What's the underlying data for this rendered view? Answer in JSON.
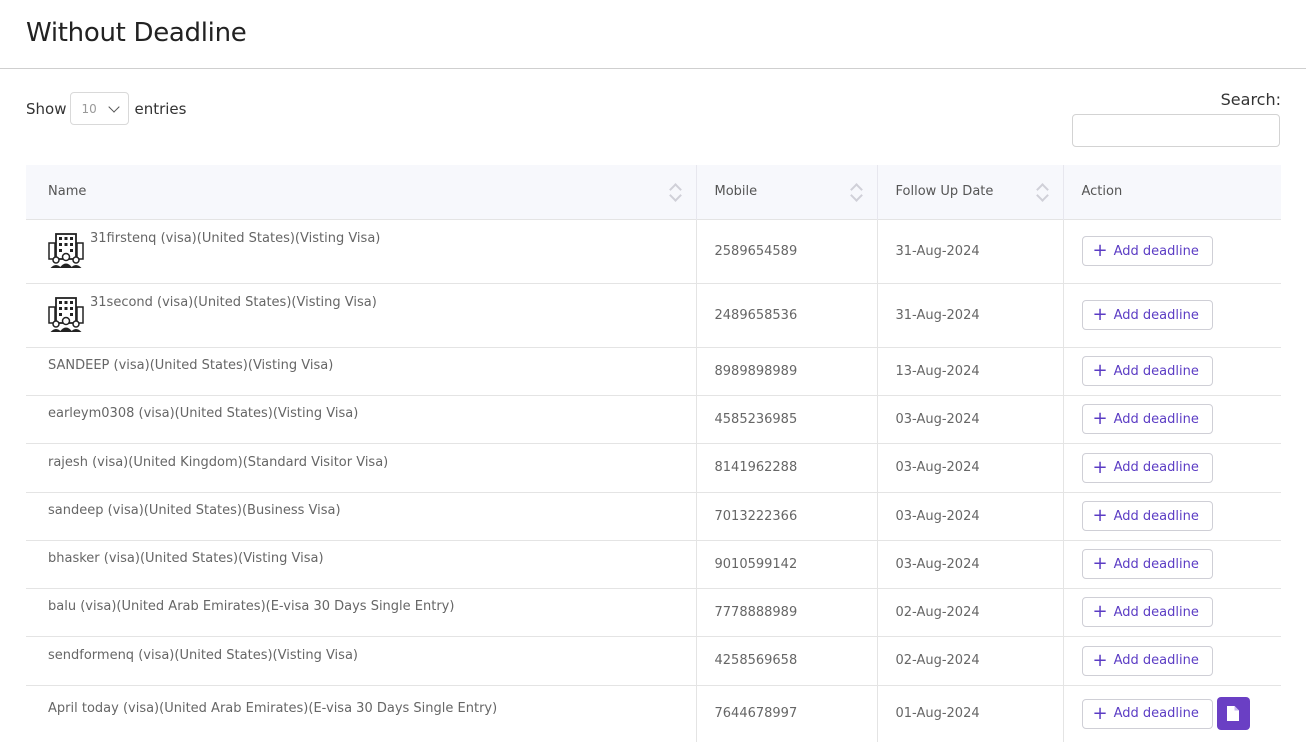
{
  "page": {
    "title": "Without Deadline"
  },
  "controls": {
    "show_label": "Show",
    "entries_value": "10",
    "entries_label": "entries",
    "search_label": "Search:",
    "search_value": ""
  },
  "table": {
    "headers": {
      "name": "Name",
      "mobile": "Mobile",
      "follow_up": "Follow Up Date",
      "action": "Action"
    },
    "action_label": "Add deadline",
    "rows": [
      {
        "name": "31firstenq (visa)(United States)(Visting Visa)",
        "mobile": "2589654589",
        "date": "31-Aug-2024",
        "icon": "business-group-icon"
      },
      {
        "name": "31second (visa)(United States)(Visting Visa)",
        "mobile": "2489658536",
        "date": "31-Aug-2024",
        "icon": "business-group-icon"
      },
      {
        "name": "SANDEEP (visa)(United States)(Visting Visa)",
        "mobile": "8989898989",
        "date": "13-Aug-2024"
      },
      {
        "name": "earleym0308 (visa)(United States)(Visting Visa)",
        "mobile": "4585236985",
        "date": "03-Aug-2024"
      },
      {
        "name": "rajesh (visa)(United Kingdom)(Standard Visitor Visa)",
        "mobile": "8141962288",
        "date": "03-Aug-2024"
      },
      {
        "name": "sandeep (visa)(United States)(Business Visa)",
        "mobile": "7013222366",
        "date": "03-Aug-2024"
      },
      {
        "name": "bhasker (visa)(United States)(Visting Visa)",
        "mobile": "9010599142",
        "date": "03-Aug-2024"
      },
      {
        "name": "balu (visa)(United Arab Emirates)(E-visa 30 Days Single Entry)",
        "mobile": "7778888989",
        "date": "02-Aug-2024"
      },
      {
        "name": "sendformenq (visa)(United States)(Visting Visa)",
        "mobile": "4258569658",
        "date": "02-Aug-2024"
      },
      {
        "name": "April today (visa)(United Arab Emirates)(E-visa 30 Days Single Entry)",
        "mobile": "7644678997",
        "date": "01-Aug-2024",
        "extra": "document-icon"
      }
    ]
  },
  "colors": {
    "accent": "#5b3cc4",
    "doc_button": "#6a3fc4",
    "header_bg": "#f7f8fc"
  }
}
